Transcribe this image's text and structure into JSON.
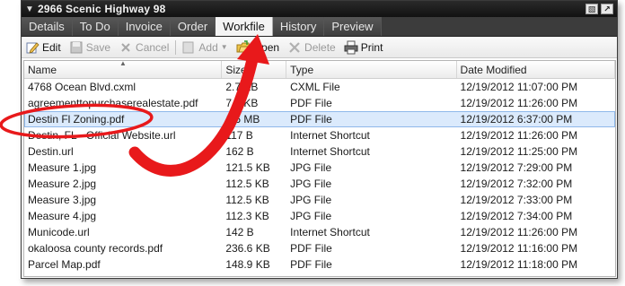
{
  "window": {
    "title": "2966 Scenic Highway 98"
  },
  "tabs": [
    {
      "label": "Details"
    },
    {
      "label": "To Do"
    },
    {
      "label": "Invoice"
    },
    {
      "label": "Order"
    },
    {
      "label": "Workfile"
    },
    {
      "label": "History"
    },
    {
      "label": "Preview"
    }
  ],
  "active_tab": "Workfile",
  "toolbar": {
    "edit": "Edit",
    "save": "Save",
    "cancel": "Cancel",
    "add": "Add",
    "open": "Open",
    "delete": "Delete",
    "print": "Print"
  },
  "columns": {
    "name": "Name",
    "size": "Size",
    "type": "Type",
    "date": "Date Modified"
  },
  "rows": [
    {
      "name": "4768 Ocean Blvd.cxml",
      "size": "2.7 KB",
      "type": "CXML File",
      "date": "12/19/2012 11:07:00 PM"
    },
    {
      "name": "agreementtopurchaserealestate.pdf",
      "size": "7.3 KB",
      "type": "PDF File",
      "date": "12/19/2012 11:26:00 PM"
    },
    {
      "name": "Destin Fl Zoning.pdf",
      "size": "1.6 MB",
      "type": "PDF File",
      "date": "12/19/2012 6:37:00 PM"
    },
    {
      "name": "Destin, FL - Official Website.url",
      "size": "117 B",
      "type": "Internet Shortcut",
      "date": "12/19/2012 11:26:00 PM"
    },
    {
      "name": "Destin.url",
      "size": "162 B",
      "type": "Internet Shortcut",
      "date": "12/19/2012 11:25:00 PM"
    },
    {
      "name": "Measure 1.jpg",
      "size": "121.5 KB",
      "type": "JPG File",
      "date": "12/19/2012 7:29:00 PM"
    },
    {
      "name": "Measure 2.jpg",
      "size": "112.5 KB",
      "type": "JPG File",
      "date": "12/19/2012 7:32:00 PM"
    },
    {
      "name": "Measure 3.jpg",
      "size": "112.5 KB",
      "type": "JPG File",
      "date": "12/19/2012 7:33:00 PM"
    },
    {
      "name": "Measure 4.jpg",
      "size": "112.3 KB",
      "type": "JPG File",
      "date": "12/19/2012 7:34:00 PM"
    },
    {
      "name": "Municode.url",
      "size": "142 B",
      "type": "Internet Shortcut",
      "date": "12/19/2012 11:26:00 PM"
    },
    {
      "name": "okaloosa county records.pdf",
      "size": "236.6 KB",
      "type": "PDF File",
      "date": "12/19/2012 11:16:00 PM"
    },
    {
      "name": "Parcel Map.pdf",
      "size": "148.9 KB",
      "type": "PDF File",
      "date": "12/19/2012 11:18:00 PM"
    }
  ],
  "selected_row": "Destin Fl Zoning.pdf",
  "annotation": {
    "color": "#e8191b"
  },
  "icons": [
    "chevron-down-icon",
    "restore-icon",
    "maximize-icon",
    "edit-icon",
    "save-icon",
    "cancel-icon",
    "add-icon",
    "open-folder-icon",
    "delete-icon",
    "print-icon",
    "sort-ascending-icon"
  ]
}
